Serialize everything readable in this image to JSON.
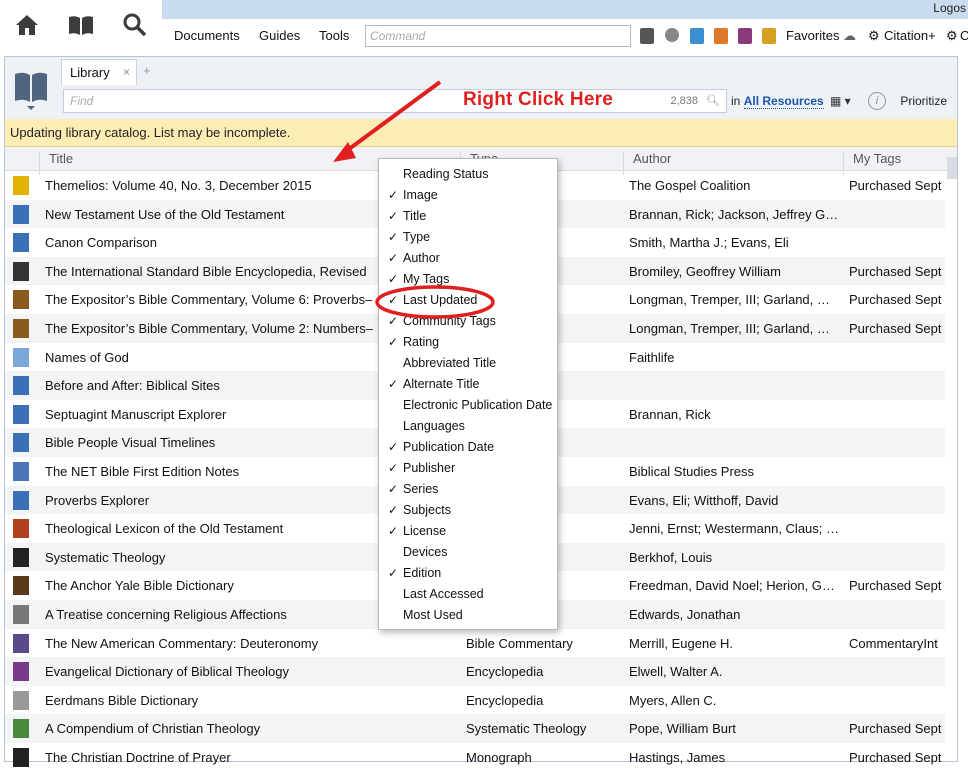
{
  "app": {
    "title": "Logos"
  },
  "nav": {
    "icons": [
      "home-icon",
      "book-icon",
      "search-icon"
    ]
  },
  "menu": {
    "items": [
      "Documents",
      "Guides",
      "Tools"
    ],
    "command_placeholder": "Command",
    "favorites": "Favorites",
    "citation": "Citation+",
    "cut": "C"
  },
  "library": {
    "tab_label": "Library",
    "tab_close": "×",
    "tab_add": "+",
    "find_placeholder": "Find",
    "count": "2,838",
    "in_label": "in",
    "resources_link": "All Resources",
    "prioritize": "Prioritize",
    "info": "i",
    "warning": "Updating library catalog. List may be incomplete.",
    "columns": [
      "Title",
      "Type",
      "Author",
      "My Tags"
    ],
    "rows": [
      {
        "title": "Themelios: Volume 40, No. 3, December 2015",
        "type": "",
        "author": "The Gospel Coalition",
        "tags": "Purchased Sept",
        "color": "#e4b200"
      },
      {
        "title": "New Testament Use of the Old Testament",
        "type": "",
        "author": "Brannan, Rick; Jackson, Jeffrey G…",
        "tags": "",
        "color": "#3b6fb6"
      },
      {
        "title": "Canon Comparison",
        "type": "",
        "author": "Smith, Martha J.; Evans, Eli",
        "tags": "",
        "color": "#3b6fb6"
      },
      {
        "title": "The International Standard Bible Encyclopedia, Revised",
        "type": "",
        "author": "Bromiley, Geoffrey William",
        "tags": "Purchased Sept",
        "color": "#333"
      },
      {
        "title": "The Expositor’s Bible Commentary, Volume 6: Proverbs–",
        "type": "ary",
        "author": "Longman, Tremper, III; Garland, …",
        "tags": "Purchased Sept",
        "color": "#8a5a1c"
      },
      {
        "title": "The Expositor’s Bible Commentary, Volume 2: Numbers–",
        "type": "ary",
        "author": "Longman, Tremper, III; Garland, …",
        "tags": "Purchased Sept",
        "color": "#8a5a1c"
      },
      {
        "title": "Names of God",
        "type": "",
        "author": "Faithlife",
        "tags": "",
        "color": "#7da7d9"
      },
      {
        "title": "Before and After: Biblical Sites",
        "type": "",
        "author": "",
        "tags": "",
        "color": "#3b6fb6"
      },
      {
        "title": "Septuagint Manuscript Explorer",
        "type": "",
        "author": "Brannan, Rick",
        "tags": "",
        "color": "#3b6fb6"
      },
      {
        "title": "Bible People Visual Timelines",
        "type": "",
        "author": "",
        "tags": "",
        "color": "#3b6fb6"
      },
      {
        "title": "The NET Bible First Edition Notes",
        "type": "",
        "author": "Biblical Studies Press",
        "tags": "",
        "color": "#4a76b8"
      },
      {
        "title": "Proverbs Explorer",
        "type": "",
        "author": "Evans, Eli; Witthoff, David",
        "tags": "",
        "color": "#3b6fb6"
      },
      {
        "title": "Theological Lexicon of the Old Testament",
        "type": "",
        "author": "Jenni, Ernst; Westermann, Claus; …",
        "tags": "",
        "color": "#b04020"
      },
      {
        "title": "Systematic Theology",
        "type": "ology",
        "author": "Berkhof, Louis",
        "tags": "",
        "color": "#222"
      },
      {
        "title": "The Anchor Yale Bible Dictionary",
        "type": "",
        "author": "Freedman, David Noel; Herion, G…",
        "tags": "Purchased Sept",
        "color": "#5a3a1a"
      },
      {
        "title": "A Treatise concerning Religious Affections",
        "type": "",
        "author": "Edwards, Jonathan",
        "tags": "",
        "color": "#777"
      },
      {
        "title": "The New American Commentary: Deuteronomy",
        "type": "Bible Commentary",
        "author": "Merrill, Eugene H.",
        "tags": "CommentaryInt",
        "color": "#5a4a8a"
      },
      {
        "title": "Evangelical Dictionary of Biblical Theology",
        "type": "Encyclopedia",
        "author": "Elwell, Walter A.",
        "tags": "",
        "color": "#7a3a8a"
      },
      {
        "title": "Eerdmans Bible Dictionary",
        "type": "Encyclopedia",
        "author": "Myers, Allen C.",
        "tags": "",
        "color": "#999"
      },
      {
        "title": "A Compendium of Christian Theology",
        "type": "Systematic Theology",
        "author": "Pope, William Burt",
        "tags": "Purchased Sept",
        "color": "#4a8a3a"
      },
      {
        "title": "The Christian Doctrine of Prayer",
        "type": "Monograph",
        "author": "Hastings, James",
        "tags": "Purchased Sept",
        "color": "#222"
      }
    ]
  },
  "context_menu": {
    "items": [
      {
        "label": "Reading Status",
        "checked": false
      },
      {
        "label": "Image",
        "checked": true
      },
      {
        "label": "Title",
        "checked": true
      },
      {
        "label": "Type",
        "checked": true
      },
      {
        "label": "Author",
        "checked": true
      },
      {
        "label": "My Tags",
        "checked": true
      },
      {
        "label": "Last Updated",
        "checked": true
      },
      {
        "label": "Community Tags",
        "checked": true
      },
      {
        "label": "Rating",
        "checked": true
      },
      {
        "label": "Abbreviated Title",
        "checked": false
      },
      {
        "label": "Alternate Title",
        "checked": true
      },
      {
        "label": "Electronic Publication Date",
        "checked": false
      },
      {
        "label": "Languages",
        "checked": false
      },
      {
        "label": "Publication Date",
        "checked": true
      },
      {
        "label": "Publisher",
        "checked": true
      },
      {
        "label": "Series",
        "checked": true
      },
      {
        "label": "Subjects",
        "checked": true
      },
      {
        "label": "License",
        "checked": true
      },
      {
        "label": "Devices",
        "checked": false
      },
      {
        "label": "Edition",
        "checked": true
      },
      {
        "label": "Last Accessed",
        "checked": false
      },
      {
        "label": "Most Used",
        "checked": false
      }
    ],
    "check_glyph": "✓"
  },
  "annotation": {
    "text": "Right Click Here",
    "color": "#e02020"
  }
}
